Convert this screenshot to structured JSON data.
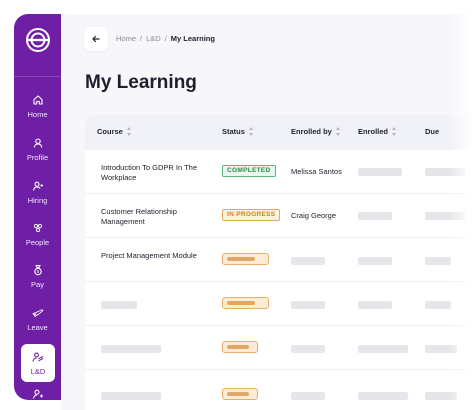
{
  "sidebar": {
    "logo_icon": "logo-icon",
    "items": [
      {
        "label": "Home",
        "icon": "home-icon"
      },
      {
        "label": "Profile",
        "icon": "profile-icon"
      },
      {
        "label": "Hiring",
        "icon": "hiring-icon"
      },
      {
        "label": "People",
        "icon": "people-icon"
      },
      {
        "label": "Pay",
        "icon": "pay-icon"
      },
      {
        "label": "Leave",
        "icon": "leave-icon"
      },
      {
        "label": "L&D",
        "icon": "learning-icon",
        "active": true
      }
    ]
  },
  "breadcrumb": {
    "items": [
      "Home",
      "L&D"
    ],
    "separator": "/",
    "current": "My Learning"
  },
  "page": {
    "title": "My Learning"
  },
  "table": {
    "columns": [
      "Course",
      "Status",
      "Enrolled by",
      "Enrolled",
      "Due"
    ],
    "rows": [
      {
        "course": "Introduction To GDPR In The Workplace",
        "status": "COMPLETED",
        "enrolled_by": "Melissa Santos"
      },
      {
        "course": "Customer Relationship Management",
        "status": "IN PROGRESS",
        "enrolled_by": "Craig George"
      },
      {
        "course": "Project Management Module",
        "status": "",
        "enrolled_by": ""
      }
    ]
  },
  "colors": {
    "brand": "#6f1fa6",
    "completed": "#2d8a48",
    "in_progress": "#c7802d"
  }
}
